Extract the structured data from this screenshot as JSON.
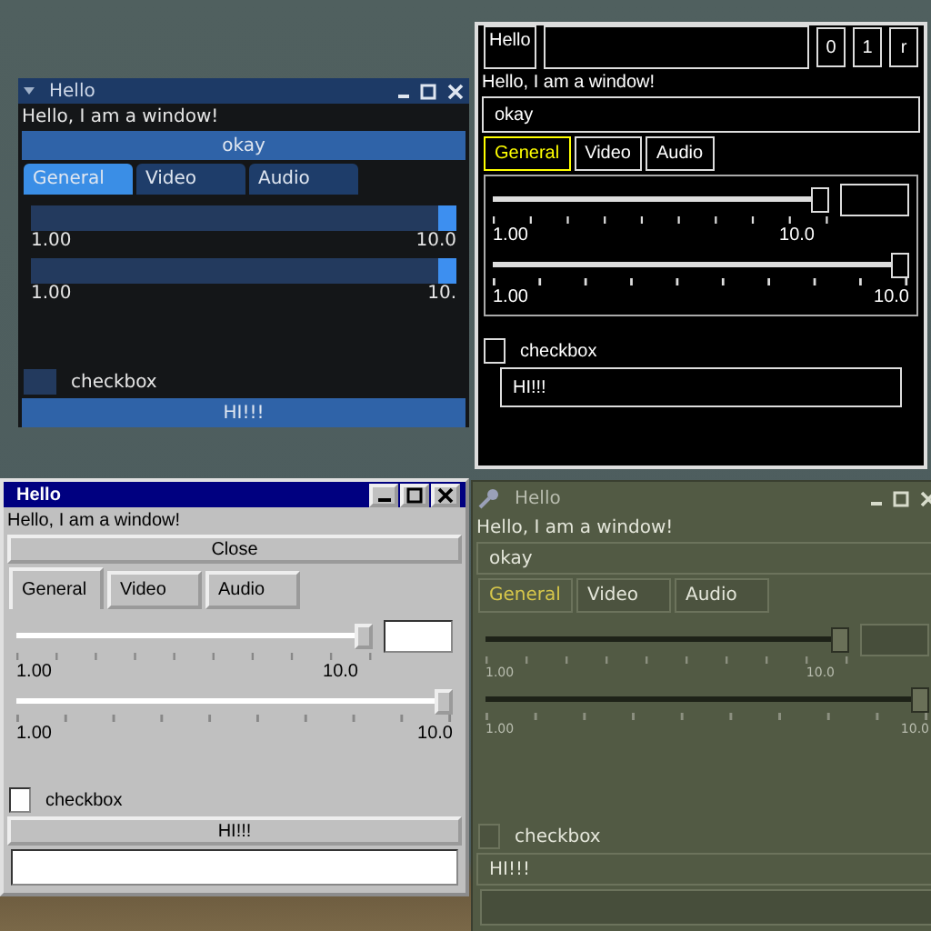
{
  "windows": [
    {
      "kind": "dark-blue",
      "title": "Hello",
      "label": "Hello, I am a window!",
      "top_button": "okay",
      "tabs": [
        {
          "label": "General",
          "selected": true
        },
        {
          "label": "Video",
          "selected": false
        },
        {
          "label": "Audio",
          "selected": false
        }
      ],
      "sliders": [
        {
          "level": 1,
          "min_label": "1.00",
          "max_label": "10.0",
          "field": false
        },
        {
          "level": 1,
          "min_label": "1.00",
          "max_label": "10.",
          "field": false
        }
      ],
      "checkbox": {
        "label": "checkbox",
        "checked": false
      },
      "bottom_button": "HI!!!",
      "input_field": false
    },
    {
      "kind": "high-contrast",
      "title": "Hello",
      "title_buttons": [
        "0",
        "1",
        "r"
      ],
      "label": "Hello, I am a window!",
      "top_button": "okay",
      "tabs": [
        {
          "label": "General",
          "selected": true
        },
        {
          "label": "Video",
          "selected": false
        },
        {
          "label": "Audio",
          "selected": false
        }
      ],
      "sliders": [
        {
          "level": 1,
          "min_label": "1.00",
          "max_label": "10.0",
          "field": true
        },
        {
          "level": 1,
          "min_label": "1.00",
          "max_label": "10.0",
          "field": false
        }
      ],
      "checkbox": {
        "label": "checkbox",
        "checked": false
      },
      "bottom_button": "HI!!!",
      "input_field": false
    },
    {
      "kind": "classic",
      "title": "Hello",
      "label": "Hello, I am a window!",
      "top_button": "Close",
      "tabs": [
        {
          "label": "General",
          "selected": true
        },
        {
          "label": "Video",
          "selected": false
        },
        {
          "label": "Audio",
          "selected": false
        }
      ],
      "sliders": [
        {
          "level": 1,
          "min_label": "1.00",
          "max_label": "10.0",
          "field": true
        },
        {
          "level": 1,
          "min_label": "1.00",
          "max_label": "10.0",
          "field": false
        }
      ],
      "checkbox": {
        "label": "checkbox",
        "checked": false
      },
      "bottom_button": "HI!!!",
      "input_field": true
    },
    {
      "kind": "olive",
      "title": "Hello",
      "label": "Hello, I am a window!",
      "top_button": "okay",
      "tabs": [
        {
          "label": "General",
          "selected": true
        },
        {
          "label": "Video",
          "selected": false
        },
        {
          "label": "Audio",
          "selected": false
        }
      ],
      "sliders": [
        {
          "level": 1,
          "min_label": "1.00",
          "max_label": "10.0",
          "field": true
        },
        {
          "level": 1,
          "min_label": "1.00",
          "max_label": "10.0",
          "field": false
        }
      ],
      "checkbox": {
        "label": "checkbox",
        "checked": false
      },
      "bottom_button": "HI!!!",
      "input_field": true
    }
  ]
}
